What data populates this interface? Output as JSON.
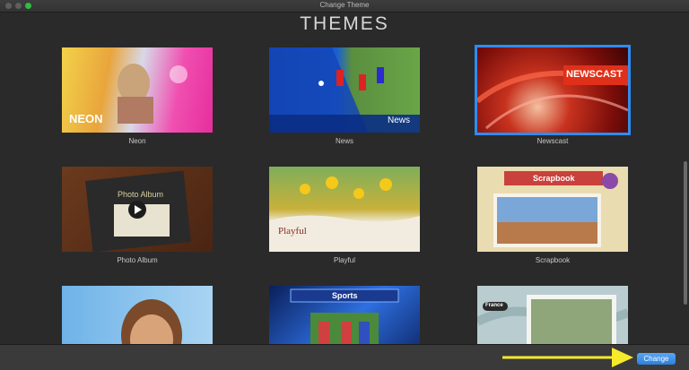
{
  "window": {
    "title": "Change Theme"
  },
  "heading": "THEMES",
  "themes": [
    {
      "name": "Neon",
      "overlay": "NEON"
    },
    {
      "name": "News",
      "overlay": "News"
    },
    {
      "name": "Newscast",
      "overlay": "NEWSCAST",
      "selected": true
    },
    {
      "name": "Photo Album",
      "overlay": "Photo Album"
    },
    {
      "name": "Playful",
      "overlay": "Playful"
    },
    {
      "name": "Scrapbook",
      "overlay": "Scrapbook"
    },
    {
      "name": "",
      "overlay": ""
    },
    {
      "name": "",
      "overlay": "Sports"
    },
    {
      "name": "",
      "overlay": "France"
    }
  ],
  "footer": {
    "change_label": "Change"
  },
  "colors": {
    "accent": "#2f8cf0",
    "annotation_arrow": "#f5ea2b"
  }
}
